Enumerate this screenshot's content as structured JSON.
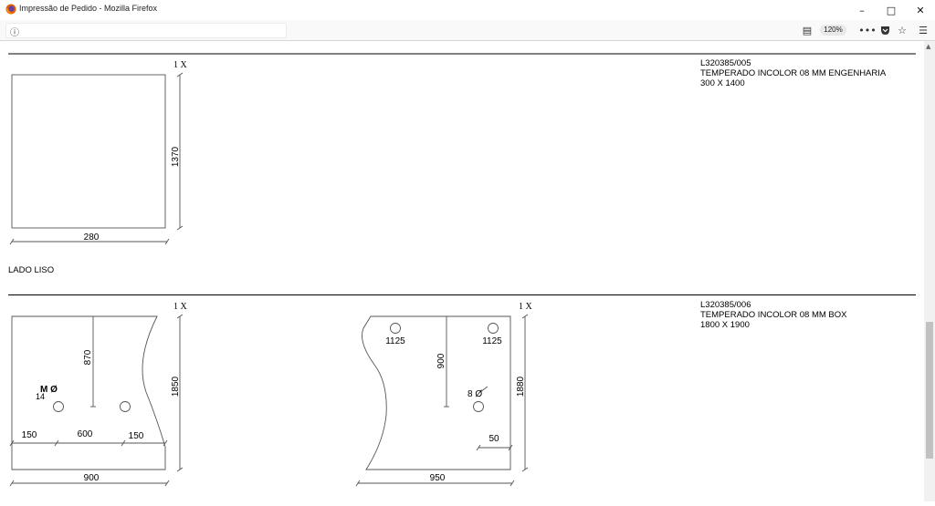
{
  "window": {
    "title": "Impressão de Pedido - Mozilla Firefox",
    "minimize_icon": "minimize-icon",
    "maximize_icon": "maximize-icon",
    "close_icon": "close-icon"
  },
  "navbar": {
    "url": "",
    "zoom": "120%",
    "icons": [
      "info-icon",
      "reader-view-icon",
      "more-icon",
      "pocket-icon",
      "bookmark-star-icon",
      "menu-icon"
    ]
  },
  "pieces": [
    {
      "code": "L320385/005",
      "desc": "TEMPERADO INCOLOR 08 MM ENGENHARIA",
      "size": "300 X 1400",
      "qty": "1 X",
      "width_dim": "280",
      "height_dim": "1370",
      "note": "LADO LISO"
    },
    {
      "code": "L320385/006",
      "desc": "TEMPERADO INCOLOR 08 MM BOX",
      "size": "1800 X 1900",
      "left_drawing": {
        "qty": "1 X",
        "width_dim": "900",
        "height_dim": "1850",
        "hole_height": "870",
        "hole_label_top": "M Ø",
        "hole_label_num": "14",
        "seg_left": "150",
        "seg_mid": "600",
        "seg_right": "150"
      },
      "right_drawing": {
        "qty": "1 X",
        "width_dim": "950",
        "height_dim": "1880",
        "hole_height": "900",
        "hole_left_label": "1125",
        "hole_right_label": "1125",
        "hole_diameter": "8 Ø",
        "edge_offset": "50"
      }
    }
  ]
}
